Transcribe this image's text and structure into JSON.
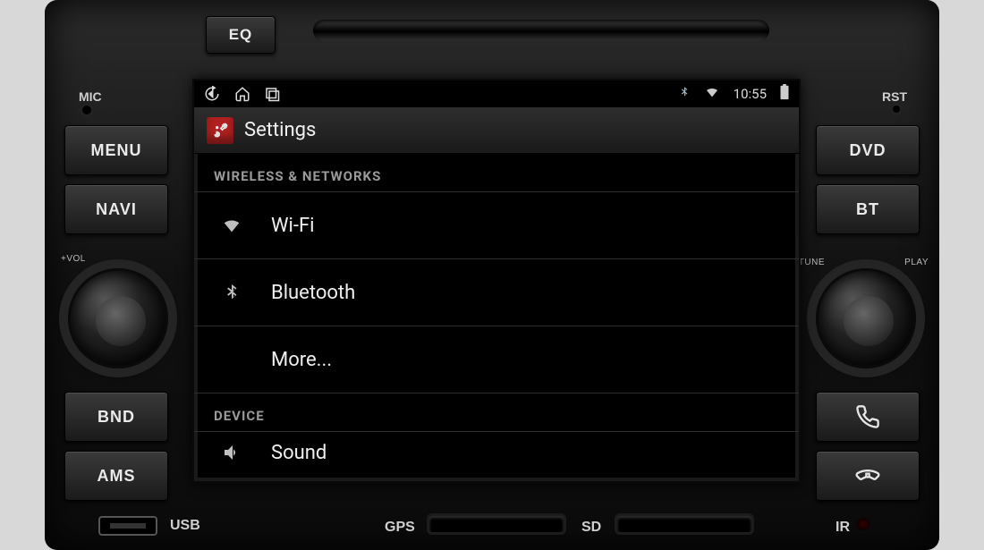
{
  "unit": {
    "buttons": {
      "eq": "EQ",
      "mic": "MIC",
      "menu": "MENU",
      "navi": "NAVI",
      "bnd": "BND",
      "ams": "AMS",
      "rst": "RST",
      "dvd": "DVD",
      "bt": "BT"
    },
    "knob_left": {
      "top": "+VOL",
      "bottom": "-"
    },
    "knob_right": {
      "left": "TUNE",
      "right": "PLAY"
    },
    "ports": {
      "usb": "USB",
      "gps": "GPS",
      "sd": "SD",
      "ir": "IR"
    }
  },
  "screen": {
    "status": {
      "time": "10:55"
    },
    "header": {
      "title": "Settings"
    },
    "sections": [
      {
        "title": "WIRELESS & NETWORKS",
        "items": [
          {
            "icon": "wifi",
            "label": "Wi-Fi"
          },
          {
            "icon": "bluetooth",
            "label": "Bluetooth"
          },
          {
            "icon": null,
            "label": "More..."
          }
        ]
      },
      {
        "title": "DEVICE",
        "items": [
          {
            "icon": "sound",
            "label": "Sound"
          }
        ]
      }
    ]
  }
}
